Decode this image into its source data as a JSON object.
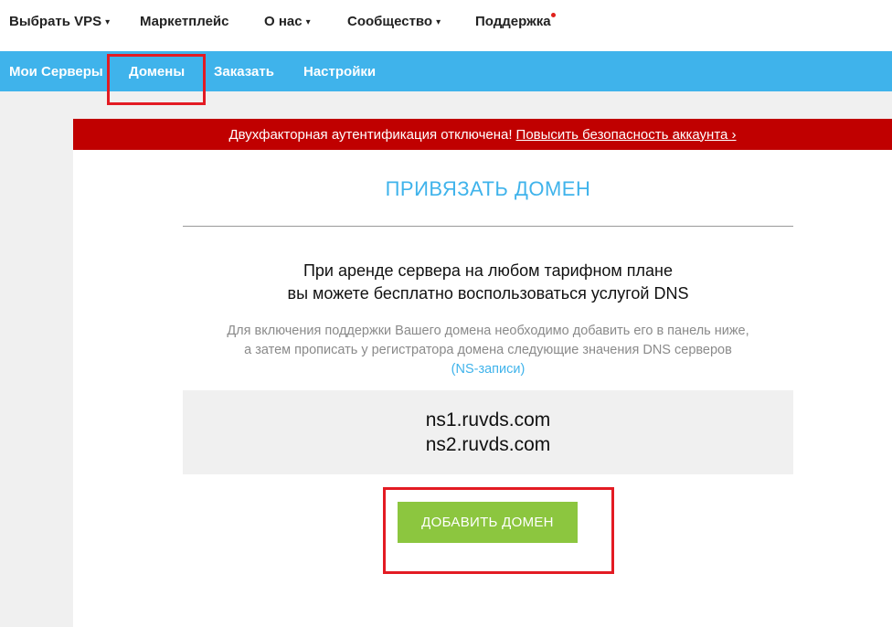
{
  "top_nav": {
    "items": [
      {
        "label": "Выбрать VPS",
        "has_caret": true
      },
      {
        "label": "Маркетплейс",
        "has_caret": false
      },
      {
        "label": "О нас",
        "has_caret": true
      },
      {
        "label": "Сообщество",
        "has_caret": true
      },
      {
        "label": "Поддержка",
        "has_caret": false
      }
    ],
    "caret_glyph": "▾",
    "notification_dot_color": "#e0201b"
  },
  "sub_nav": {
    "items": [
      {
        "label": "Мои Серверы"
      },
      {
        "label": "Домены"
      },
      {
        "label": "Заказать"
      },
      {
        "label": "Настройки"
      }
    ],
    "background": "#3fb3eb"
  },
  "alert": {
    "message": "Двухфакторная аутентификация отключена!",
    "link_label": "Повысить безопасность аккаунта ›",
    "background": "#c00000"
  },
  "main": {
    "title": "ПРИВЯЗАТЬ ДОМЕН",
    "promo_line1": "При аренде сервера на любом тарифном плане",
    "promo_line2": "вы можете бесплатно воспользоваться услугой DNS",
    "desc_line1": "Для включения поддержки Вашего домена необходимо добавить его в панель ниже,",
    "desc_line2": "а затем прописать у регистратора домена следующие значения DNS серверов",
    "desc_link": "(NS-записи)",
    "ns_servers": [
      "ns1.ruvds.com",
      "ns2.ruvds.com"
    ],
    "add_button_label": "ДОБАВИТЬ ДОМЕН",
    "accent_color": "#3fb3eb",
    "button_color": "#8cc63f"
  },
  "annotation_color": "#e31b23"
}
